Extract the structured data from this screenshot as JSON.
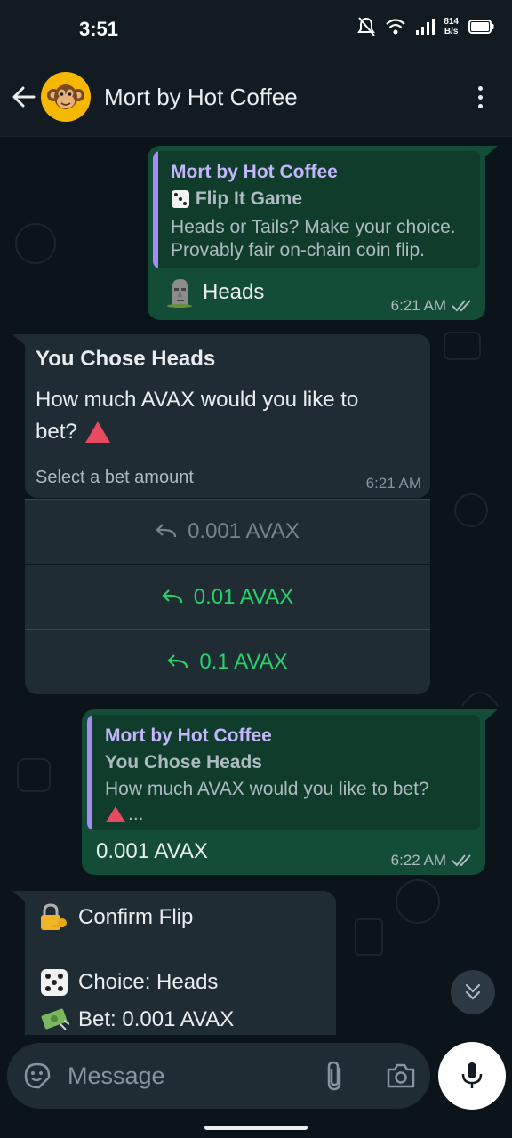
{
  "status_bar": {
    "time": "3:51",
    "speed_value": "814",
    "speed_unit": "B/s"
  },
  "header": {
    "title": "Mort by Hot Coffee"
  },
  "messages": {
    "m1": {
      "quote_author": "Mort by Hot Coffee",
      "quote_title": "Flip It Game",
      "quote_line1": "Heads or Tails? Make your choice.",
      "quote_line2": "Provably fair on-chain coin flip.",
      "text": "Heads",
      "time": "6:21 AM"
    },
    "m2": {
      "title": "You Chose Heads",
      "line1": "How much AVAX would you like to",
      "line2": "bet?",
      "footer": "Select a bet amount",
      "time": "6:21 AM",
      "buttons": [
        "0.001 AVAX",
        "0.01 AVAX",
        "0.1 AVAX"
      ]
    },
    "m3": {
      "quote_author": "Mort by Hot Coffee",
      "quote_title": "You Chose Heads",
      "quote_line1": "How much AVAX would you like to bet?",
      "quote_line2": "...",
      "text": "0.001 AVAX",
      "time": "6:22 AM"
    },
    "m4": {
      "title": "Confirm Flip",
      "choice": "Choice: Heads",
      "bet": "Bet: 0.001 AVAX"
    }
  },
  "composer": {
    "placeholder": "Message"
  },
  "icons": [
    "back-icon",
    "avatar",
    "menu-icon",
    "dice-icon",
    "moai-icon",
    "triangle-icon",
    "lock-key-icon",
    "money-icon",
    "reply-icon",
    "double-check-icon",
    "scroll-down-icon",
    "sticker-icon",
    "attach-icon",
    "camera-icon",
    "mic-icon"
  ],
  "colors": {
    "outgoing": "#144d37",
    "incoming": "#202c33",
    "accent": "#25d366",
    "quote_bar": "#a78bfa"
  }
}
